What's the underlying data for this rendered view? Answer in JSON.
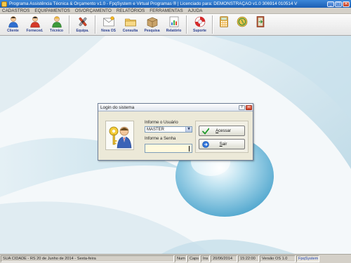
{
  "window": {
    "title": "Programa Assistência Técnica & Orçamento v1.0 - FpqSystem e Virtual Programas ® | Licenciado para: DEMONSTRAÇÃO v1.0 306914 010514 V",
    "controls": {
      "minimize": "_",
      "maximize": "□",
      "close": "×"
    }
  },
  "menu": {
    "items": [
      "CADASTROS",
      "EQUIPAMENTOS",
      "OS/ORÇAMENTO",
      "RELATÓRIOS",
      "FERRAMENTAS",
      "AJUDA"
    ]
  },
  "toolbar": {
    "buttons": [
      {
        "label": "Cliente",
        "icon": "client-person-icon"
      },
      {
        "label": "Forneced.",
        "icon": "supplier-person-icon"
      },
      {
        "label": "Técnico",
        "icon": "technician-person-icon"
      },
      {
        "label": "Equipa.",
        "icon": "tools-icon"
      },
      {
        "label": "Nova OS",
        "icon": "new-order-envelope-icon"
      },
      {
        "label": "Consulta",
        "icon": "search-folder-icon"
      },
      {
        "label": "Pesquisa",
        "icon": "box-icon"
      },
      {
        "label": "Relatório",
        "icon": "report-icon"
      },
      {
        "label": "Suporte",
        "icon": "support-lifebuoy-icon"
      },
      {
        "label": "",
        "icon": "calculator-icon"
      },
      {
        "label": "",
        "icon": "money-icon"
      },
      {
        "label": "",
        "icon": "exit-door-icon"
      }
    ]
  },
  "dialog": {
    "title": "Login do sistema",
    "controls": {
      "help": "?",
      "close": "×"
    },
    "user_label": "Informe o Usuário",
    "user_value": "MASTER",
    "password_label": "Informe a Senha",
    "password_value": "",
    "login_button": {
      "prefix": "A",
      "rest": "cessar"
    },
    "exit_button": {
      "prefix": "S",
      "rest": "air"
    },
    "avatar_icon": "user-key-icon"
  },
  "statusbar": {
    "message": "SUA CIDADE - RS 20 de Junho de 2014 - Sexta-feira",
    "num": "Num",
    "caps": "Caps",
    "ins": "Ins",
    "date": "20/06/2014",
    "time": "15:22:00",
    "version": "Versão OS 1.0",
    "brand": "FpqSystem"
  },
  "colors": {
    "titlebar": "#1b5fb4",
    "menubar": "#d4d0c8",
    "dialog": "#ece9d8",
    "password_field": "#fff9dd",
    "brand_text": "#1a3da8"
  }
}
